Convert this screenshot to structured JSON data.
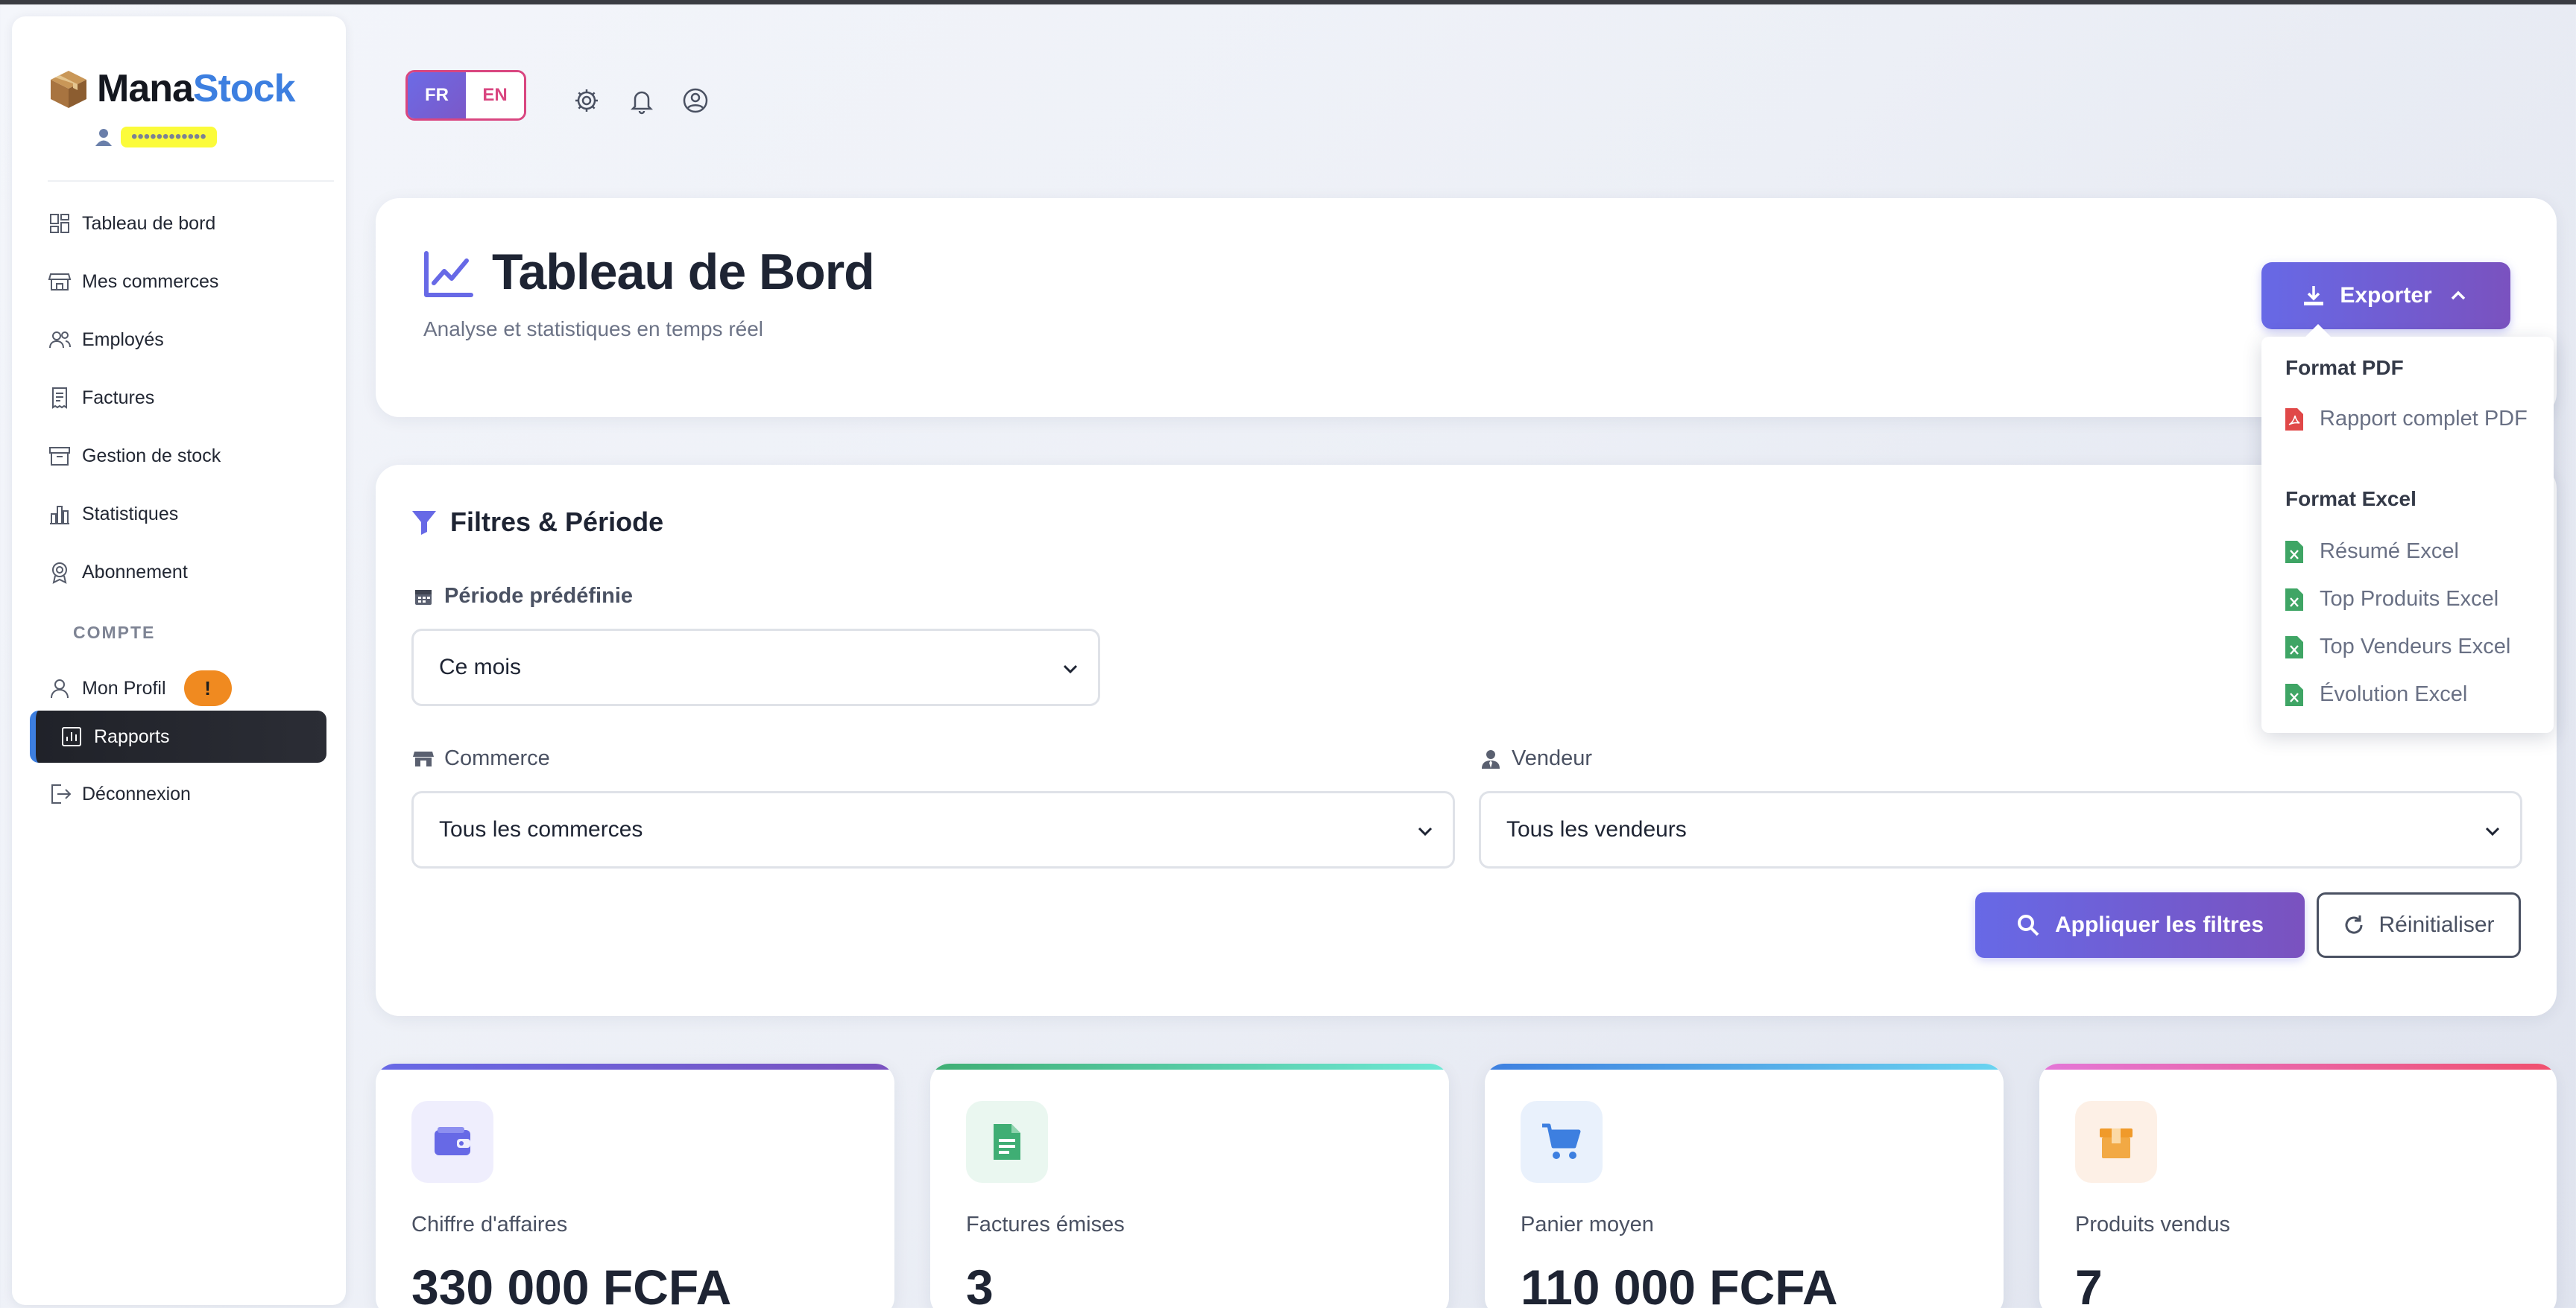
{
  "colors": {
    "accent": "#6769e6",
    "brand_blue": "#3d7fe0",
    "warning": "#f08a20",
    "pdf_red": "#e04848",
    "excel_green": "#3fa565"
  },
  "brand": {
    "part1": "Mana",
    "part2": "Stock",
    "icon": "package-box-icon"
  },
  "user": {
    "name": "••••••••••••"
  },
  "sidebar": {
    "items": [
      {
        "label": "Tableau de bord",
        "icon": "dashboard-grid-icon"
      },
      {
        "label": "Mes commerces",
        "icon": "store-icon"
      },
      {
        "label": "Employés",
        "icon": "users-icon"
      },
      {
        "label": "Factures",
        "icon": "invoice-icon"
      },
      {
        "label": "Gestion de stock",
        "icon": "archive-box-icon"
      },
      {
        "label": "Statistiques",
        "icon": "bar-chart-icon"
      },
      {
        "label": "Abonnement",
        "icon": "badge-icon"
      }
    ],
    "section_label": "COMPTE",
    "profile": {
      "label": "Mon Profil",
      "badge": "!"
    },
    "active": {
      "label": "Rapports"
    },
    "logout": {
      "label": "Déconnexion"
    }
  },
  "header": {
    "lang_fr": "FR",
    "lang_en": "EN"
  },
  "page": {
    "title": "Tableau de Bord",
    "subtitle": "Analyse et statistiques en temps réel"
  },
  "export": {
    "label": "Exporter",
    "pdf_heading": "Format PDF",
    "pdf_items": [
      "Rapport complet PDF"
    ],
    "excel_heading": "Format Excel",
    "excel_items": [
      "Résumé Excel",
      "Top Produits Excel",
      "Top Vendeurs Excel",
      "Évolution Excel"
    ]
  },
  "filters": {
    "title": "Filtres & Période",
    "period_label": "Période prédéfinie",
    "period_value": "Ce mois",
    "commerce_label": "Commerce",
    "commerce_value": "Tous les commerces",
    "vendor_label": "Vendeur",
    "vendor_value": "Tous les vendeurs",
    "apply_label": "Appliquer les filtres",
    "reset_label": "Réinitialiser"
  },
  "kpis": [
    {
      "label": "Chiffre d'affaires",
      "value": "330 000 FCFA",
      "color": "#6769e6"
    },
    {
      "label": "Factures émises",
      "value": "3",
      "color": "#3fae74"
    },
    {
      "label": "Panier moyen",
      "value": "110 000 FCFA",
      "color": "#3d7fe0"
    },
    {
      "label": "Produits vendus",
      "value": "7",
      "color": "#f09a2a"
    }
  ]
}
